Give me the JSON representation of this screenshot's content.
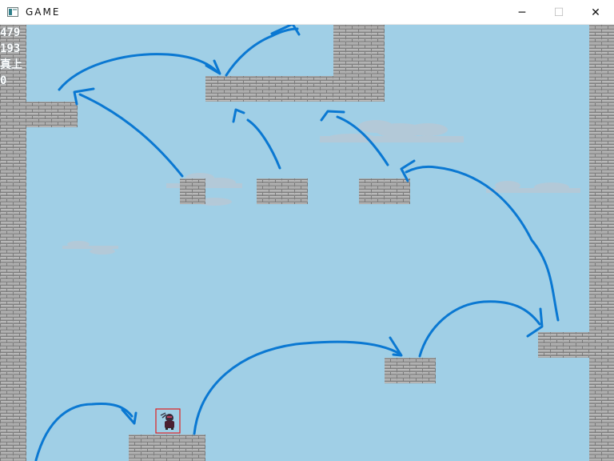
{
  "window": {
    "title": "GAME",
    "minimize_icon": "minimize-icon",
    "maximize_icon": "maximize-icon",
    "close_icon": "close-icon"
  },
  "hud": {
    "line1": "479",
    "line2": "193",
    "line3": "真上",
    "line4": "0"
  },
  "colors": {
    "sky": "#a0cfe6",
    "brick": "#a8a8a8",
    "mortar": "#7a7a7a",
    "arrow": "#0a78d2",
    "player_box": "#e02020"
  },
  "scene": {
    "player": {
      "sprite": "ninja-character",
      "highlighted": true
    },
    "arrows": 10,
    "platforms": 10
  }
}
